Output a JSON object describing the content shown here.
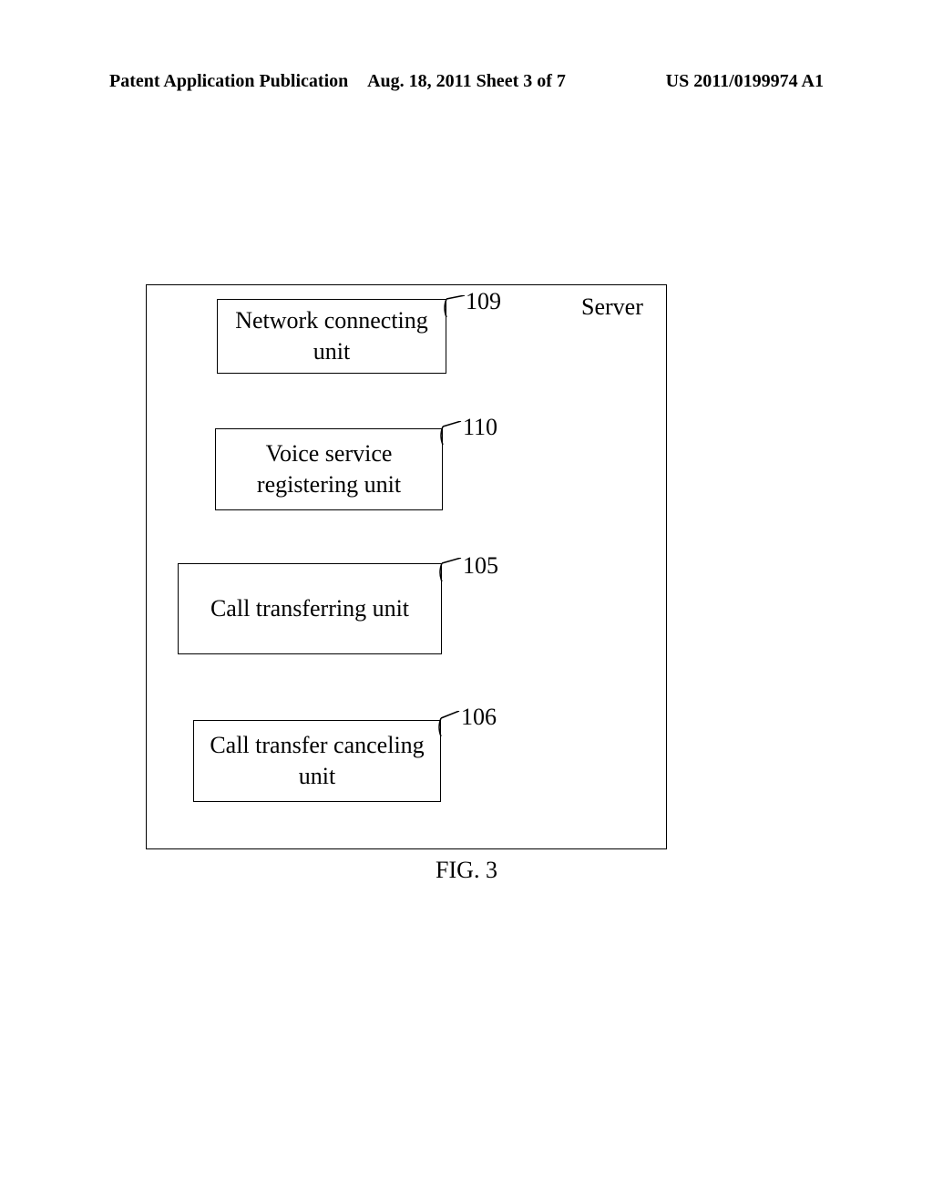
{
  "header": {
    "left": "Patent Application Publication",
    "center": "Aug. 18, 2011  Sheet 3 of 7",
    "right": "US 2011/0199974 A1"
  },
  "diagram": {
    "server_label": "Server",
    "units": [
      {
        "ref": "109",
        "label": "Network connecting unit"
      },
      {
        "ref": "110",
        "label": "Voice service registering unit"
      },
      {
        "ref": "105",
        "label": "Call transferring unit"
      },
      {
        "ref": "106",
        "label": "Call transfer canceling unit"
      }
    ],
    "caption": "FIG. 3"
  }
}
